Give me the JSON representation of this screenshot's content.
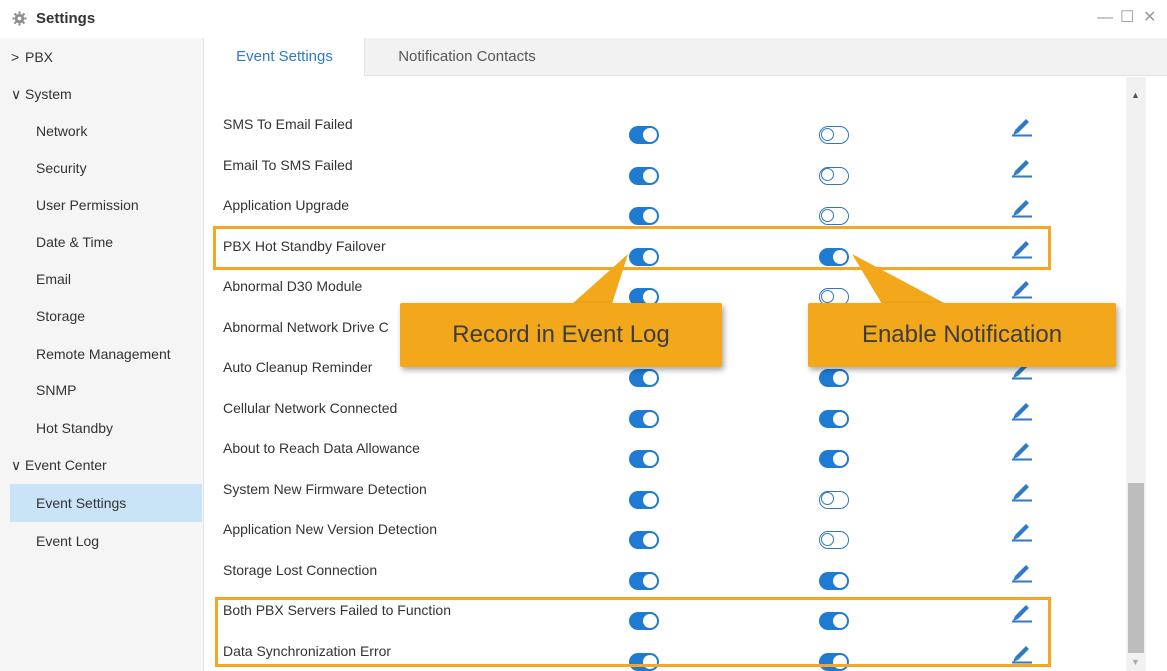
{
  "window": {
    "title": "Settings",
    "controls": {
      "minimize": "—",
      "maximize": "☐",
      "close": "✕"
    }
  },
  "sidebar": {
    "items": [
      {
        "label": "PBX",
        "type": "group",
        "caret": ">"
      },
      {
        "label": "System",
        "type": "group",
        "caret": "∨"
      },
      {
        "label": "Network",
        "type": "child"
      },
      {
        "label": "Security",
        "type": "child"
      },
      {
        "label": "User Permission",
        "type": "child"
      },
      {
        "label": "Date & Time",
        "type": "child"
      },
      {
        "label": "Email",
        "type": "child"
      },
      {
        "label": "Storage",
        "type": "child"
      },
      {
        "label": "Remote Management",
        "type": "child"
      },
      {
        "label": "SNMP",
        "type": "child"
      },
      {
        "label": "Hot Standby",
        "type": "child"
      },
      {
        "label": "Event Center",
        "type": "group",
        "caret": "∨"
      },
      {
        "label": "Event Settings",
        "type": "child",
        "active": true
      },
      {
        "label": "Event Log",
        "type": "child"
      }
    ]
  },
  "tabs": [
    {
      "label": "Event Settings",
      "active": true
    },
    {
      "label": "Notification Contacts",
      "active": false
    }
  ],
  "events": [
    {
      "name": "SMS To Email Failed",
      "record": true,
      "notify": false
    },
    {
      "name": "Email To SMS Failed",
      "record": true,
      "notify": false
    },
    {
      "name": "Application Upgrade",
      "record": true,
      "notify": false
    },
    {
      "name": "PBX Hot Standby Failover",
      "record": true,
      "notify": true
    },
    {
      "name": "Abnormal D30 Module",
      "record": true,
      "notify": false
    },
    {
      "name": "Abnormal Network Drive C",
      "record": true,
      "notify": true
    },
    {
      "name": "Auto Cleanup Reminder",
      "record": true,
      "notify": true
    },
    {
      "name": "Cellular Network Connected",
      "record": true,
      "notify": true
    },
    {
      "name": "About to Reach Data Allowance",
      "record": true,
      "notify": true
    },
    {
      "name": "System New Firmware Detection",
      "record": true,
      "notify": false
    },
    {
      "name": "Application New Version Detection",
      "record": true,
      "notify": false
    },
    {
      "name": "Storage Lost Connection",
      "record": true,
      "notify": true
    },
    {
      "name": "Both PBX Servers Failed to Function",
      "record": true,
      "notify": true
    },
    {
      "name": "Data Synchronization Error",
      "record": true,
      "notify": true
    }
  ],
  "callouts": {
    "record": "Record in Event Log",
    "notify": "Enable Notification"
  },
  "colors": {
    "accent": "#1f7ad1",
    "highlight": "#f5a623",
    "callout": "#f3a81b",
    "active_nav": "#c9e3f7"
  },
  "icons": {
    "app": "gear-icon",
    "edit": "pencil-icon"
  }
}
